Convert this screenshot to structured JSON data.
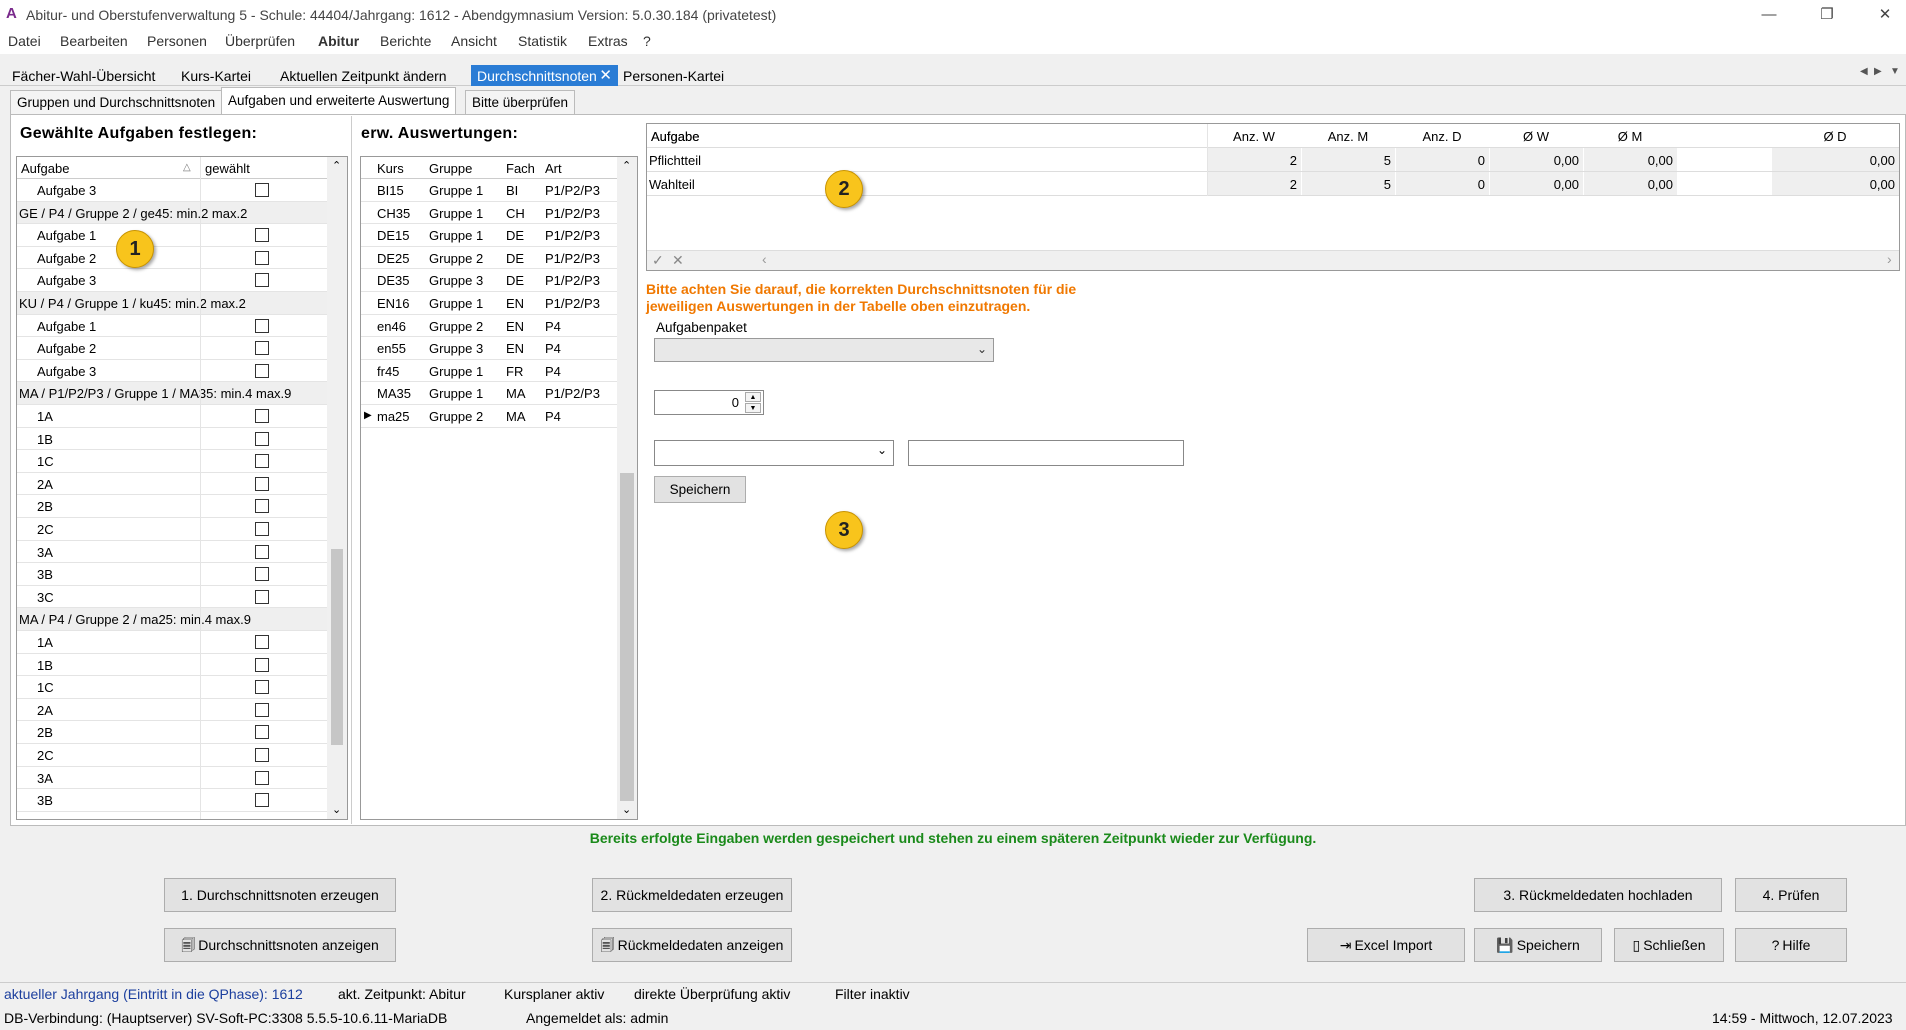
{
  "window": {
    "title": "Abitur- und Oberstufenverwaltung 5 - Schule: 44404/Jahrgang: 1612 - Abendgymnasium Version: 5.0.30.184 (privatetest)",
    "app_icon": "A"
  },
  "menu": [
    "Datei",
    "Bearbeiten",
    "Personen",
    "Überprüfen",
    "Abitur",
    "Berichte",
    "Ansicht",
    "Statistik",
    "Extras",
    "?"
  ],
  "tabs": [
    "Fächer-Wahl-Übersicht",
    "Kurs-Kartei",
    "Aktuellen Zeitpunkt ändern",
    "Durchschnittsnoten",
    "Personen-Kartei"
  ],
  "subtabs": [
    "Gruppen und Durchschnittsnoten",
    "Aufgaben und erweiterte Auswertung",
    "Bitte überprüfen"
  ],
  "left": {
    "title": "Gewählte Aufgaben festlegen:",
    "col_task": "Aufgabe",
    "col_selected": "gewählt",
    "rows": [
      {
        "type": "item",
        "label": "Aufgabe 3"
      },
      {
        "type": "group",
        "label": "GE / P4 / Gruppe 2 / ge45: min.2 max.2"
      },
      {
        "type": "item",
        "label": "Aufgabe 1"
      },
      {
        "type": "item",
        "label": "Aufgabe 2"
      },
      {
        "type": "item",
        "label": "Aufgabe 3"
      },
      {
        "type": "group",
        "label": "KU / P4 / Gruppe 1 / ku45: min.2 max.2"
      },
      {
        "type": "item",
        "label": "Aufgabe 1"
      },
      {
        "type": "item",
        "label": "Aufgabe 2"
      },
      {
        "type": "item",
        "label": "Aufgabe 3"
      },
      {
        "type": "group",
        "label": "MA / P1/P2/P3 / Gruppe 1 / MA35: min.4 max.9"
      },
      {
        "type": "item",
        "label": "1A"
      },
      {
        "type": "item",
        "label": "1B"
      },
      {
        "type": "item",
        "label": "1C"
      },
      {
        "type": "item",
        "label": "2A"
      },
      {
        "type": "item",
        "label": "2B"
      },
      {
        "type": "item",
        "label": "2C"
      },
      {
        "type": "item",
        "label": "3A"
      },
      {
        "type": "item",
        "label": "3B"
      },
      {
        "type": "item",
        "label": "3C"
      },
      {
        "type": "group",
        "label": "MA / P4 / Gruppe 2 / ma25: min.4 max.9"
      },
      {
        "type": "item",
        "label": "1A"
      },
      {
        "type": "item",
        "label": "1B"
      },
      {
        "type": "item",
        "label": "1C"
      },
      {
        "type": "item",
        "label": "2A"
      },
      {
        "type": "item",
        "label": "2B"
      },
      {
        "type": "item",
        "label": "2C"
      },
      {
        "type": "item",
        "label": "3A"
      },
      {
        "type": "item",
        "label": "3B"
      }
    ]
  },
  "middle": {
    "title": "erw. Auswertungen:",
    "headers": [
      "Kurs",
      "Gruppe",
      "Fach",
      "Art"
    ],
    "rows": [
      [
        "BI15",
        "Gruppe 1",
        "BI",
        "P1/P2/P3"
      ],
      [
        "CH35",
        "Gruppe 1",
        "CH",
        "P1/P2/P3"
      ],
      [
        "DE15",
        "Gruppe 1",
        "DE",
        "P1/P2/P3"
      ],
      [
        "DE25",
        "Gruppe 2",
        "DE",
        "P1/P2/P3"
      ],
      [
        "DE35",
        "Gruppe 3",
        "DE",
        "P1/P2/P3"
      ],
      [
        "EN16",
        "Gruppe 1",
        "EN",
        "P1/P2/P3"
      ],
      [
        "en46",
        "Gruppe 2",
        "EN",
        "P4"
      ],
      [
        "en55",
        "Gruppe 3",
        "EN",
        "P4"
      ],
      [
        "fr45",
        "Gruppe 1",
        "FR",
        "P4"
      ],
      [
        "MA35",
        "Gruppe 1",
        "MA",
        "P1/P2/P3"
      ],
      [
        "ma25",
        "Gruppe 2",
        "MA",
        "P4"
      ]
    ],
    "current_row_marker": "▶"
  },
  "right": {
    "headers": [
      "Aufgabe",
      "Anz. W",
      "Anz. M",
      "Anz. D",
      "Ø W",
      "Ø M",
      "Ø D"
    ],
    "rows": [
      [
        "Pflichtteil",
        "2",
        "5",
        "0",
        "0,00",
        "0,00",
        "0,00"
      ],
      [
        "Wahlteil",
        "2",
        "5",
        "0",
        "0,00",
        "0,00",
        "0,00"
      ]
    ],
    "warning_line1": "Bitte achten Sie darauf, die korrekten Durchschnittsnoten für die",
    "warning_line2": "jeweiligen Auswertungen in der Tabelle oben einzutragen.",
    "package_label": "Aufgabenpaket",
    "spin_value": "0",
    "save_button": "Speichern"
  },
  "badges": [
    "1",
    "2",
    "3"
  ],
  "info": "Bereits erfolgte Eingaben werden gespeichert und stehen zu einem späteren Zeitpunkt wieder zur Verfügung.",
  "buttons": {
    "b1": "1. Durchschnittsnoten erzeugen",
    "b2": "2. Rückmeldedaten erzeugen",
    "b3": "3. Rückmeldedaten hochladen",
    "b4": "4. Prüfen",
    "show_avg": "Durchschnittsnoten anzeigen",
    "show_ret": "Rückmeldedaten anzeigen",
    "excel": "Excel Import",
    "save": "Speichern",
    "close": "Schließen",
    "help": "Hilfe"
  },
  "status": {
    "year": "aktueller Jahrgang (Eintritt in die QPhase): 1612",
    "time": "akt. Zeitpunkt: Abitur",
    "planner": "Kursplaner aktiv",
    "check": "direkte Überprüfung aktiv",
    "filter": "Filter inaktiv",
    "db": "DB-Verbindung: (Hauptserver) SV-Soft-PC:3308 5.5.5-10.6.11-MariaDB",
    "user": "Angemeldet als: admin",
    "clock": "14:59 - Mittwoch, 12.07.2023"
  },
  "colors": {
    "accent": "#2a7cd5",
    "warning": "#f07800",
    "info": "#1a8a1a",
    "status_blue": "#1c3f9e",
    "badge": "#f8c41c"
  }
}
